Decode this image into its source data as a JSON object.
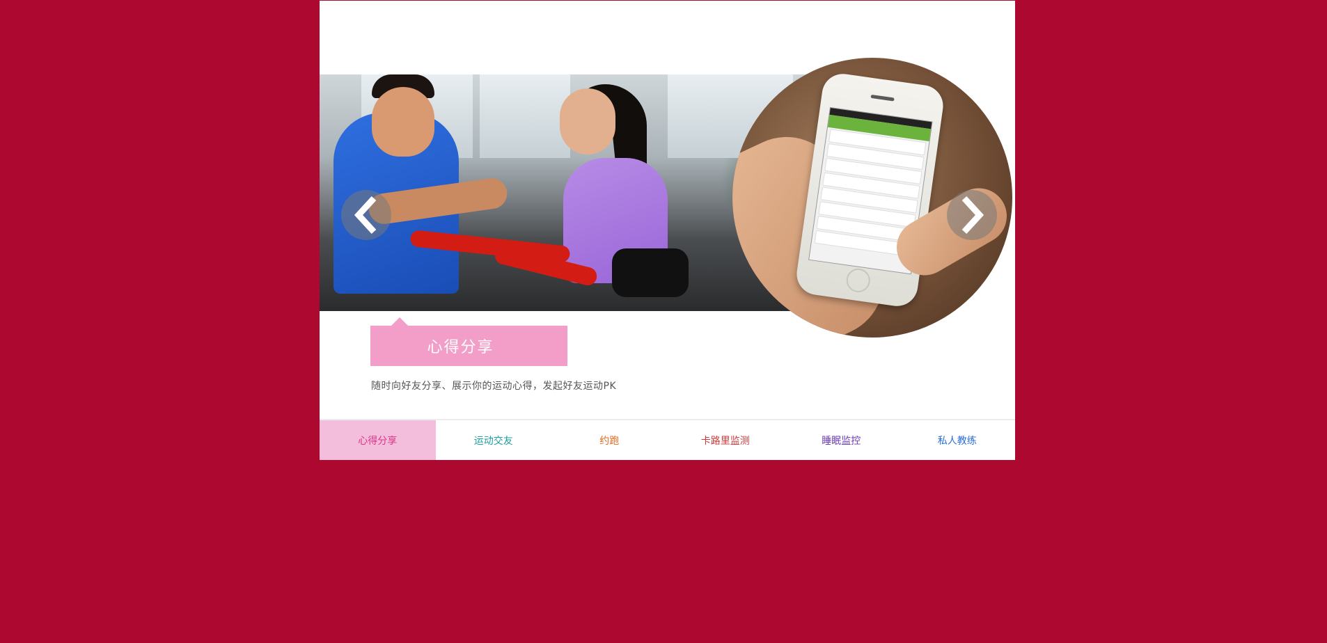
{
  "slide": {
    "caption_title": "心得分享",
    "caption_desc": "随时向好友分享、展示你的运动心得，发起好友运动PK",
    "prev_icon": "chevron-left-icon",
    "next_icon": "chevron-right-icon"
  },
  "tabs": [
    {
      "label": "心得分享",
      "color": "#e2338a",
      "underline": "#f2bedb",
      "active": true
    },
    {
      "label": "运动交友",
      "color": "#1a9f9f",
      "underline": "#6fd3e3",
      "active": false
    },
    {
      "label": "约跑",
      "color": "#e06a1c",
      "underline": "#f7b27a",
      "active": false
    },
    {
      "label": "卡路里监测",
      "color": "#d23a3a",
      "underline": "#f08a8a",
      "active": false
    },
    {
      "label": "睡眠监控",
      "color": "#6a3ab8",
      "underline": "#b69ae6",
      "active": false
    },
    {
      "label": "私人教练",
      "color": "#2a6fd8",
      "underline": "#8ab8f2",
      "active": false
    }
  ],
  "colors": {
    "page_background": "#ad0930",
    "caption_background": "#f29ec9",
    "active_tab_background": "#f2bedb"
  }
}
